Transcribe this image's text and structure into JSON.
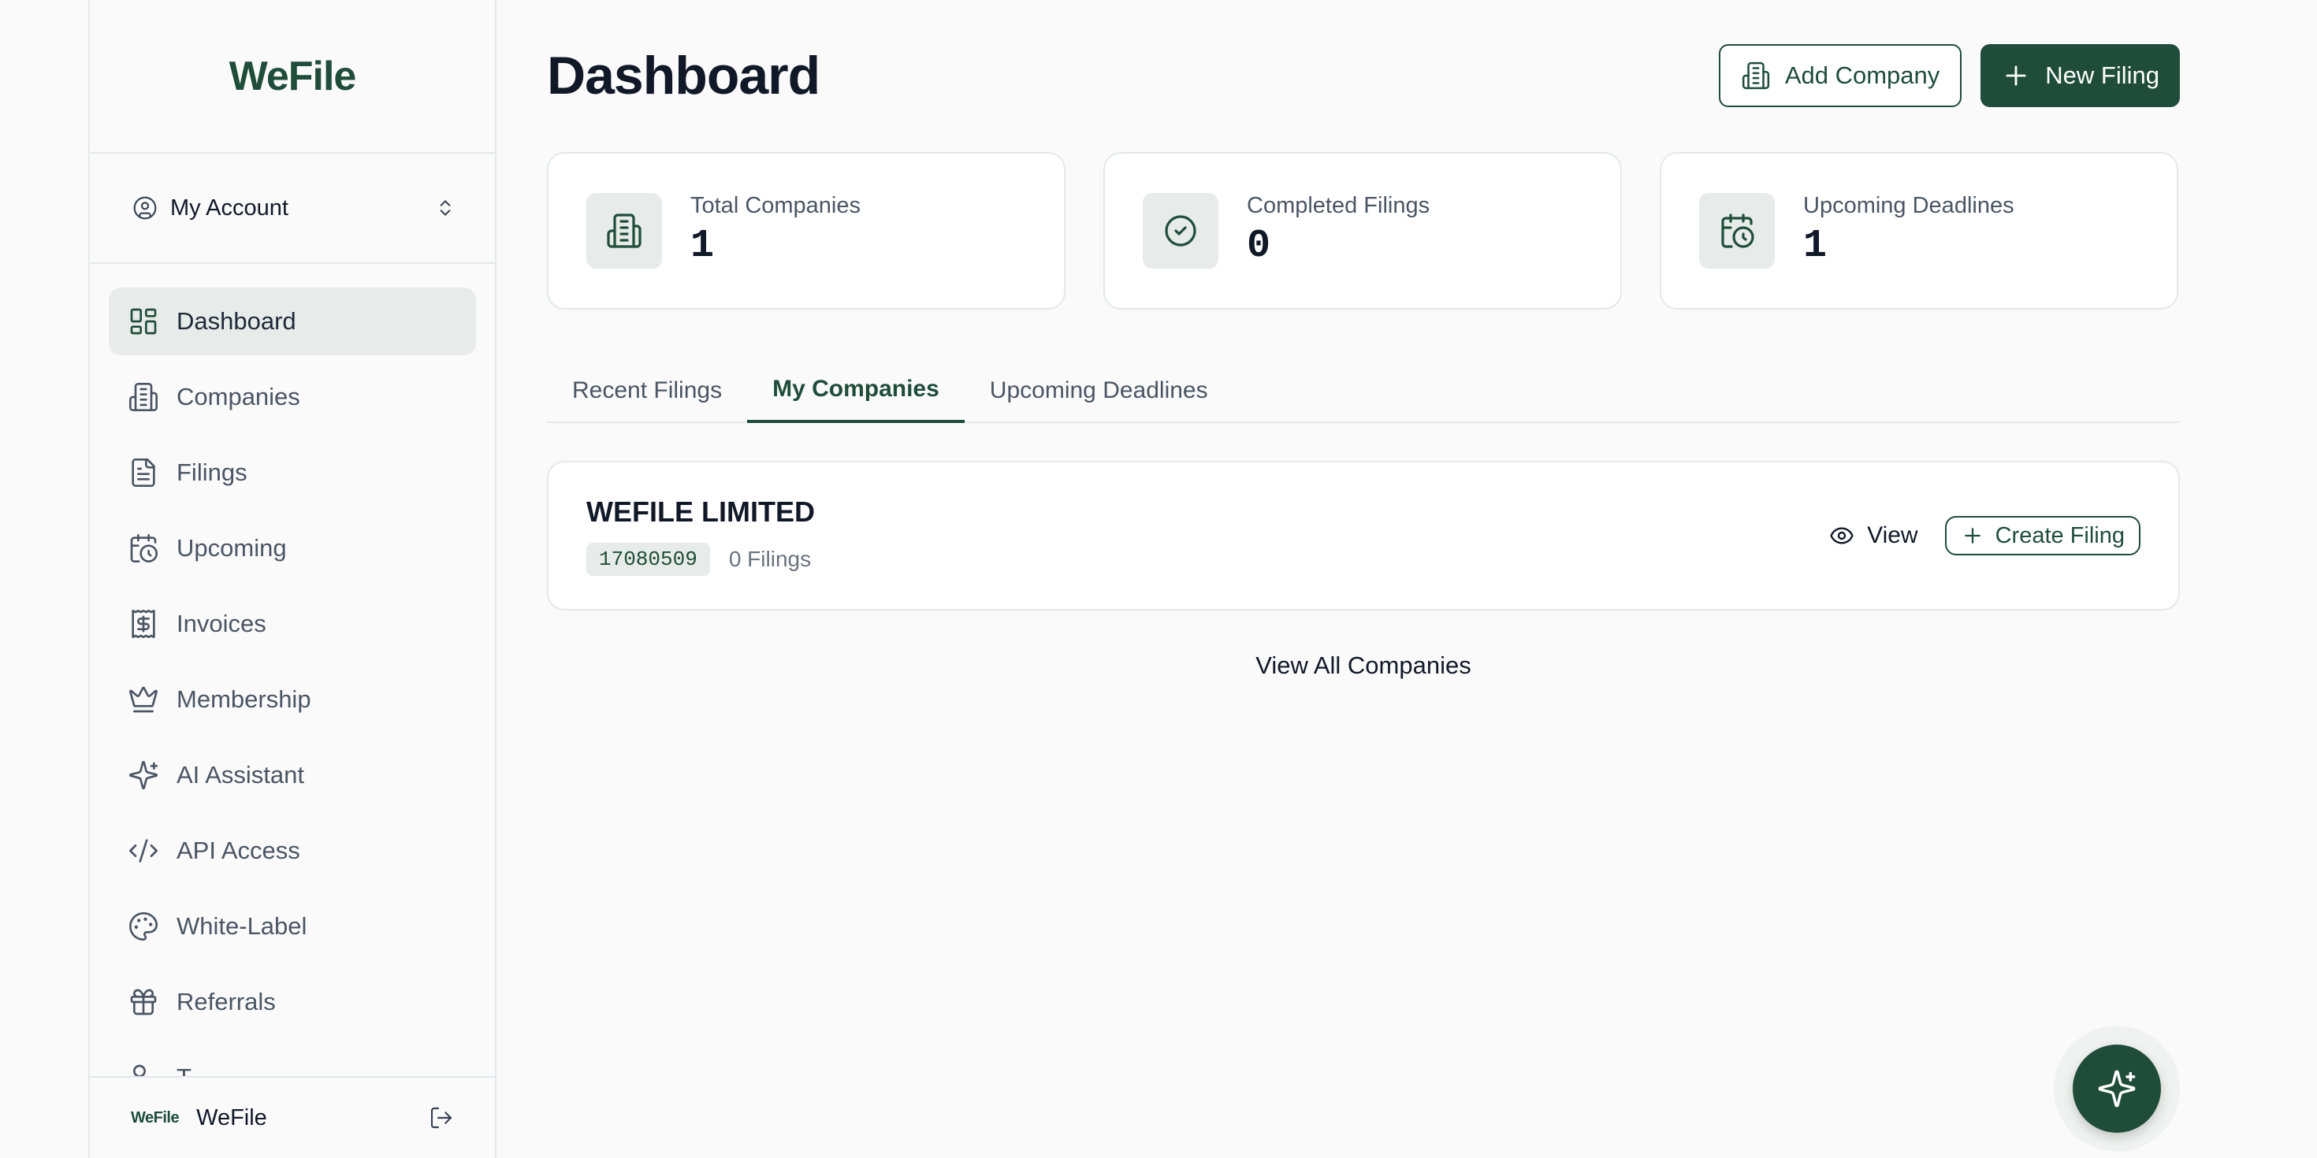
{
  "brand": {
    "logo": "WeFile",
    "accent": "#1f4d3a"
  },
  "account": {
    "label": "My Account"
  },
  "sidebar": {
    "items": [
      {
        "label": "Dashboard",
        "icon": "dashboard-icon",
        "active": true
      },
      {
        "label": "Companies",
        "icon": "building-icon"
      },
      {
        "label": "Filings",
        "icon": "file-icon"
      },
      {
        "label": "Upcoming",
        "icon": "calendar-clock-icon"
      },
      {
        "label": "Invoices",
        "icon": "invoice-icon"
      },
      {
        "label": "Membership",
        "icon": "crown-icon"
      },
      {
        "label": "AI Assistant",
        "icon": "sparkles-icon"
      },
      {
        "label": "API Access",
        "icon": "code-icon"
      },
      {
        "label": "White-Label",
        "icon": "palette-icon"
      },
      {
        "label": "Referrals",
        "icon": "gift-icon"
      },
      {
        "label": "T...",
        "icon": "users-icon"
      }
    ],
    "footer": {
      "logo": "WeFile",
      "name": "WeFile"
    }
  },
  "header": {
    "title": "Dashboard",
    "add_company": "Add Company",
    "new_filing": "New Filing"
  },
  "stats": [
    {
      "label": "Total Companies",
      "value": "1",
      "icon": "building-icon"
    },
    {
      "label": "Completed Filings",
      "value": "0",
      "icon": "check-circle-icon"
    },
    {
      "label": "Upcoming Deadlines",
      "value": "1",
      "icon": "calendar-clock-icon"
    }
  ],
  "tabs": [
    {
      "label": "Recent Filings"
    },
    {
      "label": "My Companies",
      "active": true
    },
    {
      "label": "Upcoming Deadlines"
    }
  ],
  "company": {
    "name": "WEFILE LIMITED",
    "number": "17080509",
    "filings": "0 Filings",
    "view": "View",
    "create_filing": "Create Filing"
  },
  "view_all": "View All Companies"
}
